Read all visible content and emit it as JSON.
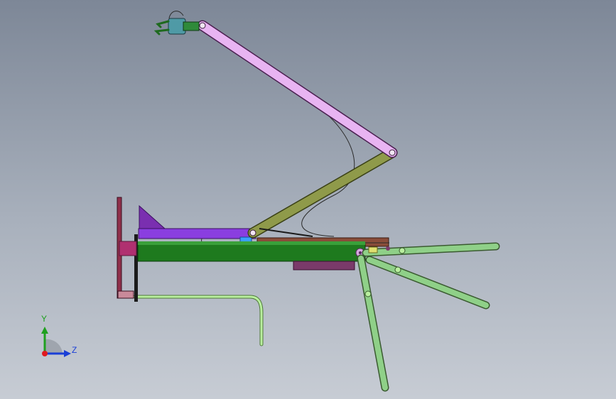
{
  "triad": {
    "y_label": "Y",
    "z_label": "Z",
    "colors": {
      "y": "#1fa01f",
      "z": "#1a3fd6",
      "x": "#e0191f"
    }
  },
  "colors": {
    "background_top": "#7d8797",
    "background_bottom": "#c7ccd4",
    "upper_arm": "#e8b4f2",
    "lower_arm": "#8f9a4a",
    "boom_purple": "#8a3ee0",
    "main_beam": "#1e7a1e",
    "top_rail": "#8a4d3a",
    "legs": "#8fd088",
    "handle_tube": "#b9ef9f",
    "gripper": "#4f9aa6",
    "base_plate": "#8f2f4a",
    "support_bracket": "#7a2fb0"
  }
}
